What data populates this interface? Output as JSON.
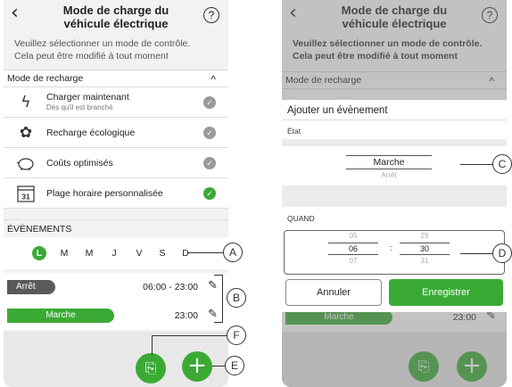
{
  "left_screen": {
    "title_line1": "Mode de charge du",
    "title_line2": "véhicule électrique",
    "help_label": "?",
    "subtitle_line1": "Veuillez sélectionner un mode de contrôle.",
    "subtitle_line2": "Cela peut être modifié à tout moment",
    "recharge_section": "Mode de recharge",
    "modes": [
      {
        "label": "Charger maintenant",
        "sub": "Dès qu'il est branché",
        "icon": "lightning-icon",
        "selected": false
      },
      {
        "label": "Recharge écologique",
        "sub": "",
        "icon": "eco-flower-icon",
        "selected": false
      },
      {
        "label": "Coûts optimisés",
        "sub": "",
        "icon": "piggy-bank-icon",
        "selected": false
      },
      {
        "label": "Plage horaire personnalisée",
        "sub": "",
        "icon": "calendar-31-icon",
        "calendar_number": "31",
        "selected": true
      }
    ],
    "events_section": "ÉVÈNEMENTS",
    "days": [
      "L",
      "M",
      "M",
      "J",
      "V",
      "S",
      "D"
    ],
    "selected_day_index": 0,
    "events": [
      {
        "state": "Arrêt",
        "time": "06:00 - 23:00"
      },
      {
        "state": "Marche",
        "time": "23:00"
      }
    ]
  },
  "right_screen": {
    "title_line1": "Mode de charge du",
    "title_line2": "véhicule électrique",
    "help_label": "?",
    "subtitle_line1": "Veuillez sélectionner un mode de contrôle.",
    "subtitle_line2": "Cela peut être modifié à tout moment",
    "recharge_section": "Mode de recharge",
    "behind_pill": "Marche",
    "behind_time": "23:00",
    "dialog": {
      "title": "Ajouter un évènement",
      "state_label": "État",
      "state_selected": "Marche",
      "state_below": "Arrêt",
      "when_label": "QUAND",
      "hours": [
        "05",
        "06",
        "07"
      ],
      "minutes": [
        "29",
        "30",
        "31"
      ],
      "separator": ":",
      "cancel_label": "Annuler",
      "save_label": "Enregistrer"
    }
  },
  "callouts": {
    "a": "A",
    "b": "B",
    "c": "C",
    "d": "D",
    "e": "E",
    "f": "F"
  },
  "colors": {
    "accent": "#3aaa35",
    "off_pill": "#5a5a5a"
  }
}
